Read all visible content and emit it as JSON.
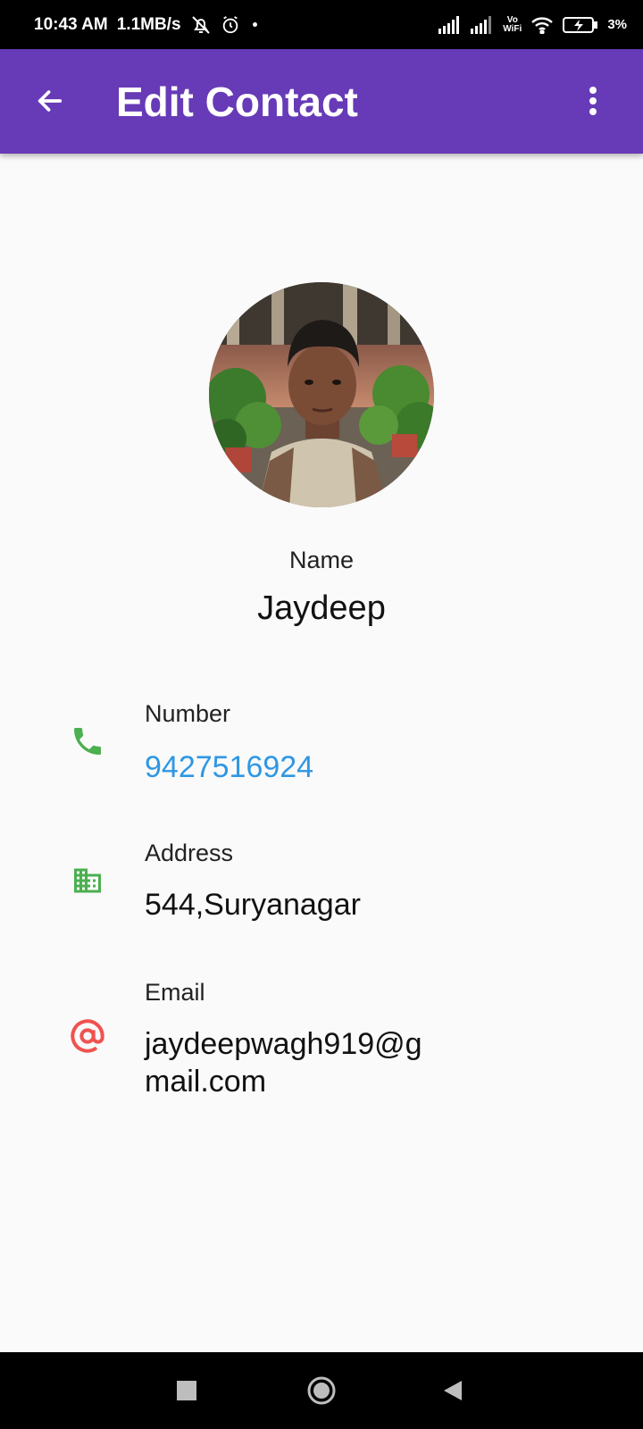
{
  "status_bar": {
    "time": "10:43 AM",
    "speed": "1.1MB/s",
    "wifi_label_top": "Vo",
    "wifi_label_bottom": "WiFi",
    "battery_percent": "3%"
  },
  "app_bar": {
    "title": "Edit Contact",
    "background": "#673ab7"
  },
  "contact": {
    "name_label": "Name",
    "name": "Jaydeep",
    "number_label": "Number",
    "number": "9427516924",
    "address_label": "Address",
    "address": "544,Suryanagar",
    "email_label": "Email",
    "email": "jaydeepwagh919@gmail.com"
  },
  "icons": {
    "phone": "phone-icon",
    "address": "building-icon",
    "email": "at-sign-icon"
  },
  "colors": {
    "phone_icon": "#4caf50",
    "address_icon": "#4caf50",
    "email_icon": "#ef5350",
    "number_text": "#2f97e3"
  }
}
